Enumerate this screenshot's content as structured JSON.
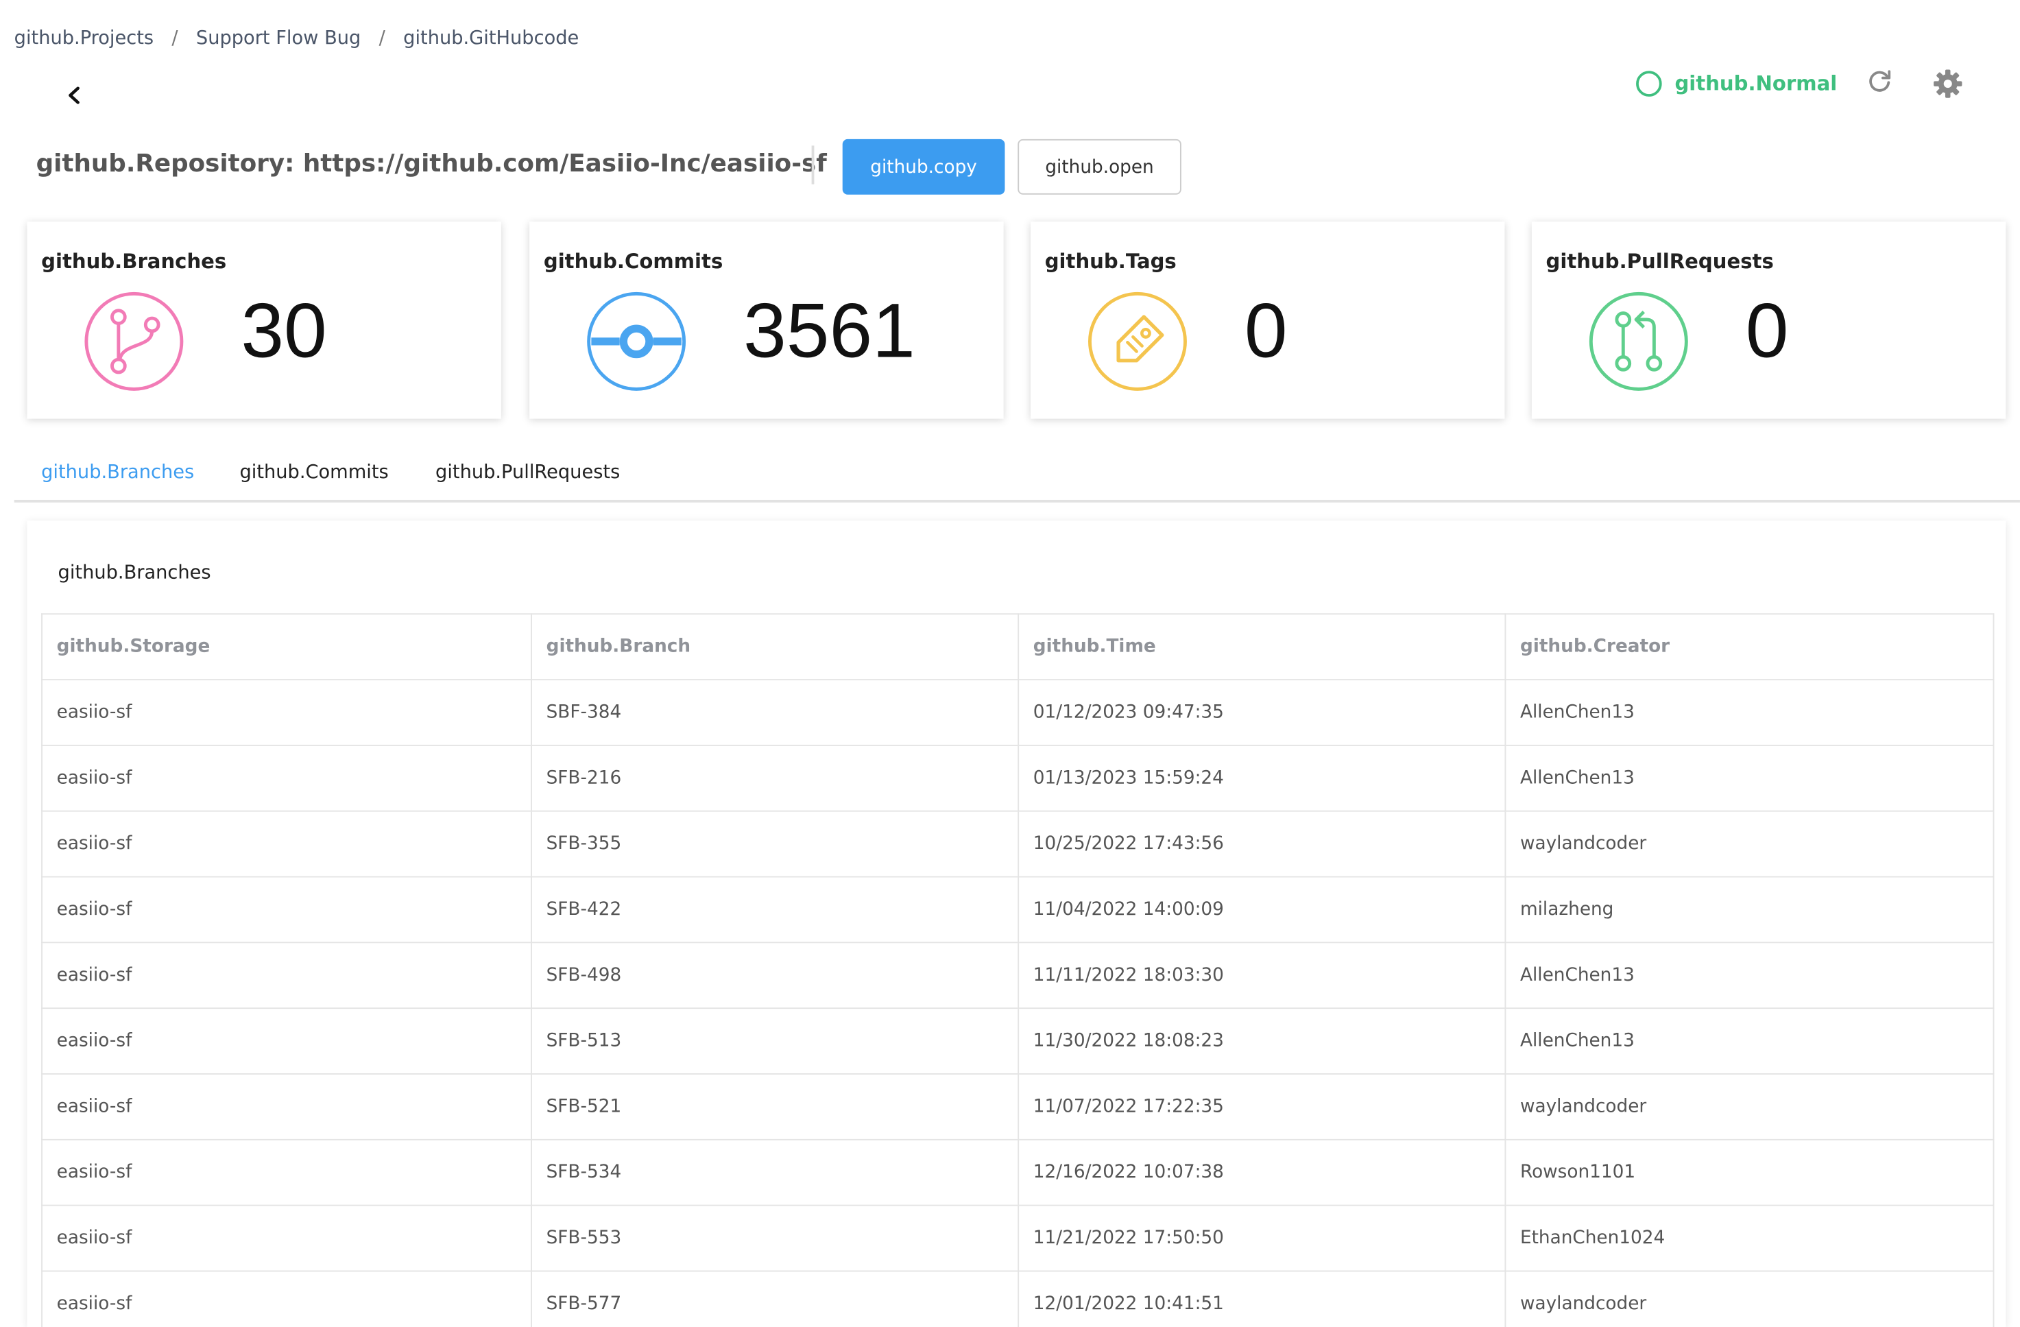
{
  "breadcrumb": {
    "items": [
      "github.Projects",
      "Support Flow Bug",
      "github.GitHubcode"
    ],
    "separator": "/"
  },
  "status": {
    "label": "github.Normal",
    "color": "#3fbf7f"
  },
  "repository": {
    "title": "github.Repository: https://github.com/Easiio-Inc/easiio-sf",
    "copy_label": "github.copy",
    "open_label": "github.open"
  },
  "stats": [
    {
      "label": "github.Branches",
      "value": "30",
      "icon": "branch-icon",
      "color": "#f27bb6"
    },
    {
      "label": "github.Commits",
      "value": "3561",
      "icon": "commit-icon",
      "color": "#4aa5f0"
    },
    {
      "label": "github.Tags",
      "value": "0",
      "icon": "tag-icon",
      "color": "#f4c44e"
    },
    {
      "label": "github.PullRequests",
      "value": "0",
      "icon": "pull-request-icon",
      "color": "#5fcf8c"
    }
  ],
  "tabs": [
    {
      "label": "github.Branches",
      "active": true
    },
    {
      "label": "github.Commits",
      "active": false
    },
    {
      "label": "github.PullRequests",
      "active": false
    }
  ],
  "branches_table": {
    "title": "github.Branches",
    "columns": [
      "github.Storage",
      "github.Branch",
      "github.Time",
      "github.Creator"
    ],
    "rows": [
      [
        "easiio-sf",
        "SBF-384",
        "01/12/2023 09:47:35",
        "AllenChen13"
      ],
      [
        "easiio-sf",
        "SFB-216",
        "01/13/2023 15:59:24",
        "AllenChen13"
      ],
      [
        "easiio-sf",
        "SFB-355",
        "10/25/2022 17:43:56",
        "waylandcoder"
      ],
      [
        "easiio-sf",
        "SFB-422",
        "11/04/2022 14:00:09",
        "milazheng"
      ],
      [
        "easiio-sf",
        "SFB-498",
        "11/11/2022 18:03:30",
        "AllenChen13"
      ],
      [
        "easiio-sf",
        "SFB-513",
        "11/30/2022 18:08:23",
        "AllenChen13"
      ],
      [
        "easiio-sf",
        "SFB-521",
        "11/07/2022 17:22:35",
        "waylandcoder"
      ],
      [
        "easiio-sf",
        "SFB-534",
        "12/16/2022 10:07:38",
        "Rowson1101"
      ],
      [
        "easiio-sf",
        "SFB-553",
        "11/21/2022 17:50:50",
        "EthanChen1024"
      ],
      [
        "easiio-sf",
        "SFB-577",
        "12/01/2022 10:41:51",
        "waylandcoder"
      ]
    ]
  }
}
